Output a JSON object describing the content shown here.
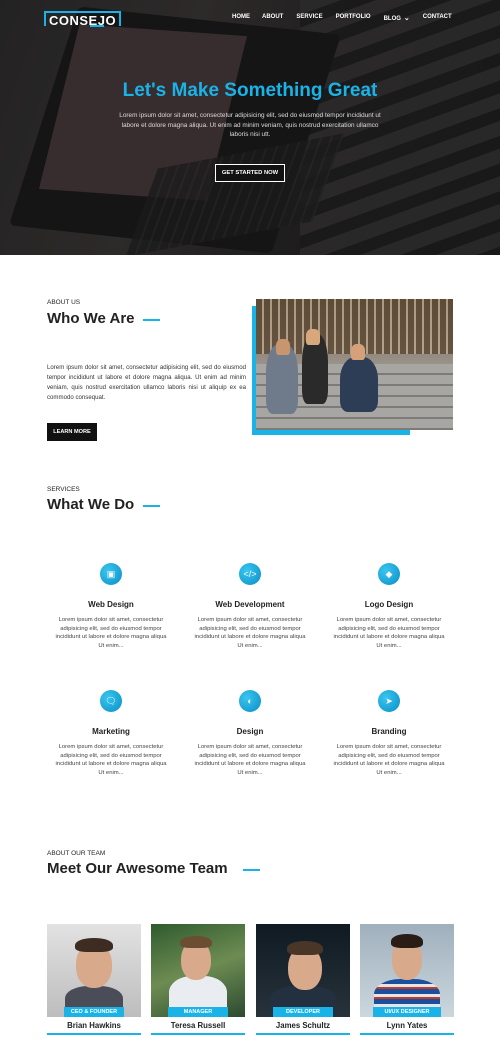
{
  "brand": {
    "logo": "CONSEJO",
    "accent": "#1ab3e8"
  },
  "nav": {
    "items": [
      {
        "label": "HOME"
      },
      {
        "label": "ABOUT"
      },
      {
        "label": "SERVICE"
      },
      {
        "label": "PORTFOLIO"
      },
      {
        "label": "BLOG"
      },
      {
        "label": "CONTACT"
      }
    ],
    "blog_dropdown_icon": "chevron-down-icon"
  },
  "hero": {
    "title": "Let's Make Something Great",
    "text": "Lorem ipsum dolor sit amet, consectetur adipisicing elit, sed do eiusmod tempor incididunt ut labore et dolore magna aliqua. Ut enim ad minim veniam, quis nostrud exercitation ullamco laboris nisi utt.",
    "cta": "GET STARTED NOW"
  },
  "about": {
    "eyebrow": "ABOUT US",
    "title": "Who We Are",
    "text": "Lorem ipsum dolor sit amet, consectetur adipisicing elit, sed do eiusmod tempor incididunt ut labore et dolore magna aliqua. Ut enim ad minim veniam, quis nostrud exercitation ullamco laboris nisi ut aliquip ex ea commodo consequat.",
    "button": "LEARN MORE"
  },
  "services": {
    "eyebrow": "SERVICES",
    "title": "What We Do",
    "items": [
      {
        "title": "Web Design",
        "icon": "monitor-icon",
        "text": "Lorem ipsum dolor sit amet, consectetur adipisicing elit, sed do eiusmod tempor incididunt ut labore et dolore magna aliqua Ut enim..."
      },
      {
        "title": "Web Development",
        "icon": "code-icon",
        "text": "Lorem ipsum dolor sit amet, consectetur adipisicing elit, sed do eiusmod tempor incididunt ut labore et dolore magna aliqua Ut enim..."
      },
      {
        "title": "Logo Design",
        "icon": "diamond-icon",
        "text": "Lorem ipsum dolor sit amet, consectetur adipisicing elit, sed do eiusmod tempor incididunt ut labore et dolore magna aliqua Ut enim..."
      },
      {
        "title": "Marketing",
        "icon": "chat-bubbles-icon",
        "text": "Lorem ipsum dolor sit amet, consectetur adipisicing elit, sed do eiusmod tempor incididunt ut labore et dolore magna aliqua Ut enim..."
      },
      {
        "title": "Design",
        "icon": "palette-icon",
        "text": "Lorem ipsum dolor sit amet, consectetur adipisicing elit, sed do eiusmod tempor incididunt ut labore et dolore magna aliqua Ut enim..."
      },
      {
        "title": "Branding",
        "icon": "rocket-icon",
        "text": "Lorem ipsum dolor sit amet, consectetur adipisicing elit, sed do eiusmod tempor incididunt ut labore et dolore magna aliqua Ut enim..."
      }
    ]
  },
  "team": {
    "eyebrow": "ABOUT OUR TEAM",
    "title": "Meet Our Awesome Team",
    "members": [
      {
        "name": "Brian Hawkins",
        "role": "CEO & FOUNDER"
      },
      {
        "name": "Teresa Russell",
        "role": "MANAGER"
      },
      {
        "name": "James Schultz",
        "role": "DEVELOPER"
      },
      {
        "name": "Lynn Yates",
        "role": "UI/UX DESIGNER"
      }
    ]
  }
}
